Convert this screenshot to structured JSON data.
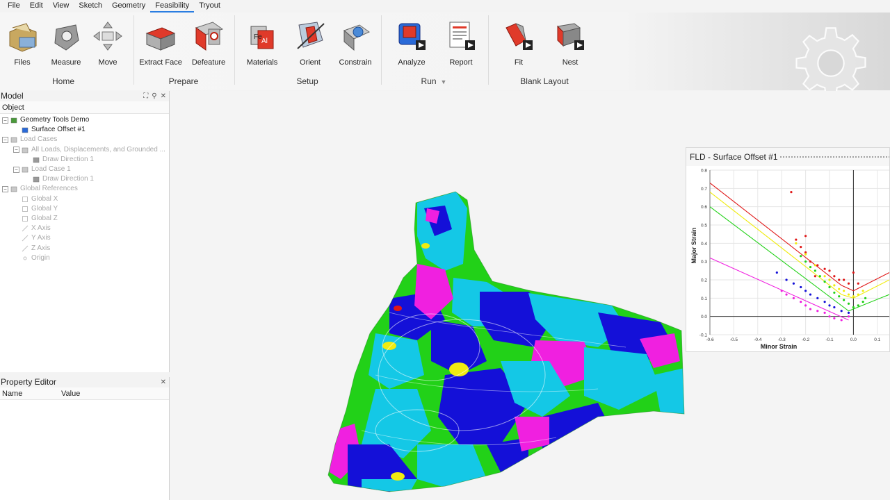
{
  "menu": [
    "File",
    "Edit",
    "View",
    "Sketch",
    "Geometry",
    "Feasibility",
    "Tryout"
  ],
  "active_menu": "Feasibility",
  "ribbon": {
    "tools": [
      {
        "label": "Files",
        "icon": "folder-icon"
      },
      {
        "label": "Measure",
        "icon": "measure-icon"
      },
      {
        "label": "Move",
        "icon": "move-icon"
      },
      {
        "label": "Extract Face",
        "icon": "extract-face-icon"
      },
      {
        "label": "Defeature",
        "icon": "defeature-icon"
      },
      {
        "label": "Materials",
        "icon": "materials-icon"
      },
      {
        "label": "Orient",
        "icon": "orient-icon"
      },
      {
        "label": "Constrain",
        "icon": "constrain-icon"
      },
      {
        "label": "Analyze",
        "icon": "analyze-icon"
      },
      {
        "label": "Report",
        "icon": "report-icon"
      },
      {
        "label": "Fit",
        "icon": "fit-icon"
      },
      {
        "label": "Nest",
        "icon": "nest-icon"
      }
    ],
    "groups": [
      "Home",
      "Prepare",
      "Setup",
      "Run",
      "Blank Layout"
    ],
    "materials_glyphs": [
      "Fe",
      "Al"
    ]
  },
  "model_panel": {
    "title": "Model",
    "column": "Object",
    "tree": [
      {
        "label": "Geometry Tools Demo",
        "level": 0,
        "toggle": "−",
        "icon": "assembly-icon",
        "dim": false
      },
      {
        "label": "Surface Offset #1",
        "level": 1,
        "toggle": "",
        "icon": "surface-icon",
        "dim": false
      },
      {
        "label": "Load Cases",
        "level": 0,
        "toggle": "−",
        "icon": "folder-icon",
        "dim": true
      },
      {
        "label": "All Loads, Displacements, and Grounded ...",
        "level": 1,
        "toggle": "−",
        "icon": "folder-icon",
        "dim": true
      },
      {
        "label": "Draw Direction 1",
        "level": 2,
        "toggle": "",
        "icon": "direction-icon",
        "dim": true
      },
      {
        "label": "Load Case 1",
        "level": 1,
        "toggle": "−",
        "icon": "folder-icon",
        "dim": true
      },
      {
        "label": "Draw Direction 1",
        "level": 2,
        "toggle": "",
        "icon": "direction-icon",
        "dim": true
      },
      {
        "label": "Global References",
        "level": 0,
        "toggle": "−",
        "icon": "folder-icon",
        "dim": true
      },
      {
        "label": "Global X",
        "level": 1,
        "toggle": "",
        "icon": "plane-icon",
        "dim": true
      },
      {
        "label": "Global Y",
        "level": 1,
        "toggle": "",
        "icon": "plane-icon",
        "dim": true
      },
      {
        "label": "Global Z",
        "level": 1,
        "toggle": "",
        "icon": "plane-icon",
        "dim": true
      },
      {
        "label": "X Axis",
        "level": 1,
        "toggle": "",
        "icon": "axis-icon",
        "dim": true
      },
      {
        "label": "Y Axis",
        "level": 1,
        "toggle": "",
        "icon": "axis-icon",
        "dim": true
      },
      {
        "label": "Z Axis",
        "level": 1,
        "toggle": "",
        "icon": "axis-icon",
        "dim": true
      },
      {
        "label": "Origin",
        "level": 1,
        "toggle": "",
        "icon": "origin-icon",
        "dim": true
      }
    ]
  },
  "property_panel": {
    "title": "Property Editor",
    "columns": [
      "Name",
      "Value"
    ]
  },
  "colors": {
    "green": "#22d118",
    "cyan": "#14c8e6",
    "blue": "#1410d8",
    "magenta": "#f020e0",
    "yellow": "#f0ec10",
    "red": "#e01818",
    "accent": "#2a7de1"
  },
  "chart_data": {
    "type": "scatter",
    "title": "FLD - Surface Offset #1",
    "xlabel": "Minor Strain",
    "ylabel": "Major Strain",
    "xlim": [
      -0.6,
      0.15
    ],
    "ylim": [
      -0.1,
      0.8
    ],
    "xticks": [
      "-0.6",
      "-0.5",
      "-0.4",
      "-0.3",
      "-0.2",
      "-0.1",
      "0.0",
      "0.1"
    ],
    "yticks": [
      "0.8",
      "0.7",
      "0.6",
      "0.5",
      "0.4",
      "0.3",
      "0.2",
      "0.1",
      "0.0",
      "-0.1"
    ],
    "grid": true,
    "limit_lines": [
      {
        "color": "#e01818",
        "points": [
          [
            -0.6,
            0.73
          ],
          [
            -0.05,
            0.17
          ],
          [
            0.0,
            0.14
          ],
          [
            0.15,
            0.24
          ]
        ]
      },
      {
        "color": "#f0ec10",
        "points": [
          [
            -0.6,
            0.68
          ],
          [
            -0.05,
            0.12
          ],
          [
            0.0,
            0.1
          ],
          [
            0.15,
            0.2
          ]
        ]
      },
      {
        "color": "#22d118",
        "points": [
          [
            -0.6,
            0.6
          ],
          [
            -0.02,
            0.03
          ],
          [
            0.15,
            0.12
          ]
        ]
      },
      {
        "color": "#f020e0",
        "points": [
          [
            -0.6,
            0.32
          ],
          [
            -0.02,
            -0.02
          ]
        ]
      }
    ],
    "series": [
      {
        "color": "#e01818",
        "points": [
          [
            -0.26,
            0.68
          ],
          [
            -0.24,
            0.42
          ],
          [
            -0.22,
            0.38
          ],
          [
            -0.2,
            0.35
          ],
          [
            -0.18,
            0.3
          ],
          [
            -0.15,
            0.28
          ],
          [
            -0.12,
            0.26
          ],
          [
            -0.1,
            0.25
          ],
          [
            -0.08,
            0.22
          ],
          [
            -0.06,
            0.2
          ],
          [
            -0.04,
            0.2
          ],
          [
            -0.02,
            0.18
          ],
          [
            0.0,
            0.24
          ],
          [
            0.02,
            0.18
          ],
          [
            -0.16,
            0.22
          ],
          [
            -0.2,
            0.44
          ]
        ]
      },
      {
        "color": "#f0ec10",
        "points": [
          [
            -0.24,
            0.4
          ],
          [
            -0.2,
            0.34
          ],
          [
            -0.16,
            0.28
          ],
          [
            -0.12,
            0.22
          ],
          [
            -0.1,
            0.2
          ],
          [
            -0.08,
            0.17
          ],
          [
            -0.06,
            0.15
          ],
          [
            -0.04,
            0.14
          ],
          [
            -0.02,
            0.12
          ],
          [
            0.0,
            0.11
          ],
          [
            0.02,
            0.12
          ],
          [
            0.04,
            0.14
          ]
        ]
      },
      {
        "color": "#22d118",
        "points": [
          [
            -0.22,
            0.33
          ],
          [
            -0.2,
            0.3
          ],
          [
            -0.18,
            0.27
          ],
          [
            -0.16,
            0.25
          ],
          [
            -0.14,
            0.22
          ],
          [
            -0.12,
            0.19
          ],
          [
            -0.1,
            0.16
          ],
          [
            -0.08,
            0.13
          ],
          [
            -0.06,
            0.11
          ],
          [
            -0.04,
            0.09
          ],
          [
            -0.02,
            0.07
          ],
          [
            0.0,
            0.05
          ],
          [
            0.02,
            0.06
          ],
          [
            0.04,
            0.08
          ],
          [
            0.05,
            0.1
          ]
        ]
      },
      {
        "color": "#1410d8",
        "points": [
          [
            -0.32,
            0.24
          ],
          [
            -0.28,
            0.2
          ],
          [
            -0.25,
            0.18
          ],
          [
            -0.22,
            0.16
          ],
          [
            -0.2,
            0.14
          ],
          [
            -0.18,
            0.12
          ],
          [
            -0.15,
            0.1
          ],
          [
            -0.12,
            0.08
          ],
          [
            -0.1,
            0.06
          ],
          [
            -0.08,
            0.05
          ],
          [
            -0.05,
            0.03
          ],
          [
            -0.02,
            0.02
          ]
        ]
      },
      {
        "color": "#f020e0",
        "points": [
          [
            -0.3,
            0.14
          ],
          [
            -0.28,
            0.12
          ],
          [
            -0.25,
            0.1
          ],
          [
            -0.22,
            0.08
          ],
          [
            -0.2,
            0.06
          ],
          [
            -0.18,
            0.04
          ],
          [
            -0.15,
            0.03
          ],
          [
            -0.12,
            0.02
          ],
          [
            -0.1,
            0.0
          ],
          [
            -0.08,
            -0.01
          ],
          [
            -0.05,
            -0.02
          ],
          [
            -0.02,
            0.0
          ]
        ]
      }
    ]
  }
}
